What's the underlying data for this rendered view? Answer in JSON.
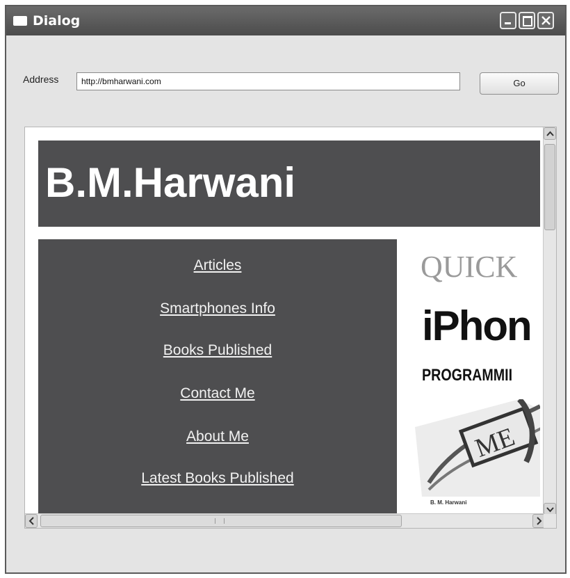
{
  "window": {
    "title": "Dialog"
  },
  "address_bar": {
    "label": "Address",
    "value": "http://bmharwani.com",
    "go_label": "Go"
  },
  "site": {
    "title": "B.M.Harwani",
    "nav": [
      {
        "label": "Articles"
      },
      {
        "label": "Smartphones Info"
      },
      {
        "label": "Books Published"
      },
      {
        "label": "Contact Me"
      },
      {
        "label": "About Me"
      },
      {
        "label": "Latest Books Published"
      }
    ],
    "book_cover": {
      "series": "QUICK",
      "title": "iPhon",
      "subtitle": "PROGRAMMII",
      "badge": "ME",
      "author": "B. M. Harwani"
    }
  },
  "colors": {
    "titlebar": "#565656",
    "header_bg": "#4e4e50",
    "nav_bg": "#4e4e50",
    "link": "#f2f2f2"
  }
}
